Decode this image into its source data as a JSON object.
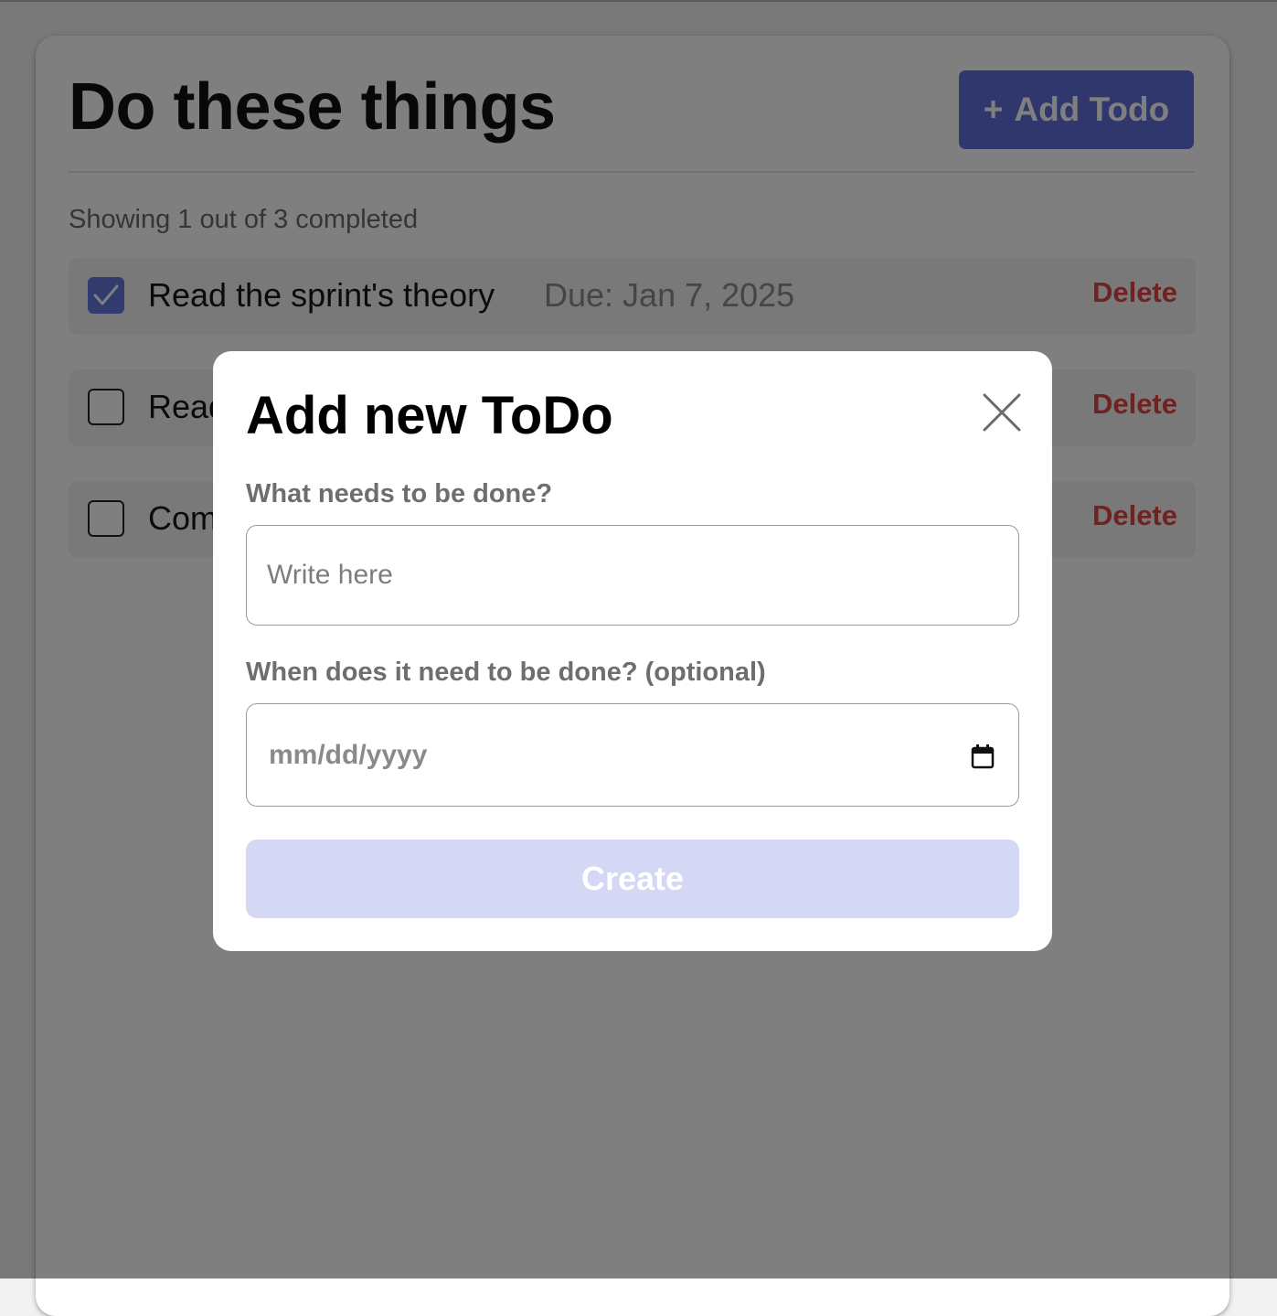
{
  "header": {
    "title": "Do these things",
    "add_button_icon": "+",
    "add_button_label": "Add Todo"
  },
  "summary": "Showing 1 out of 3 completed",
  "todos": [
    {
      "text": "Read the sprint's theory",
      "due": "Due: Jan 7, 2025",
      "completed": true,
      "delete_label": "Delete"
    },
    {
      "text": "Read",
      "due": "",
      "completed": false,
      "delete_label": "Delete"
    },
    {
      "text": "Com",
      "due": "",
      "completed": false,
      "delete_label": "Delete"
    }
  ],
  "modal": {
    "title": "Add new ToDo",
    "close_icon": "close-icon",
    "task_label": "What needs to be done?",
    "task_placeholder": "Write here",
    "task_value": "",
    "date_label": "When does it need to be done? (optional)",
    "date_placeholder": "mm/dd/yyyy",
    "calendar_icon": "calendar-icon",
    "create_label": "Create"
  },
  "colors": {
    "accent": "#6576dc",
    "delete": "#e04545",
    "create_disabled": "#d4d8f5",
    "overlay": "rgba(0,0,0,0.5)"
  }
}
